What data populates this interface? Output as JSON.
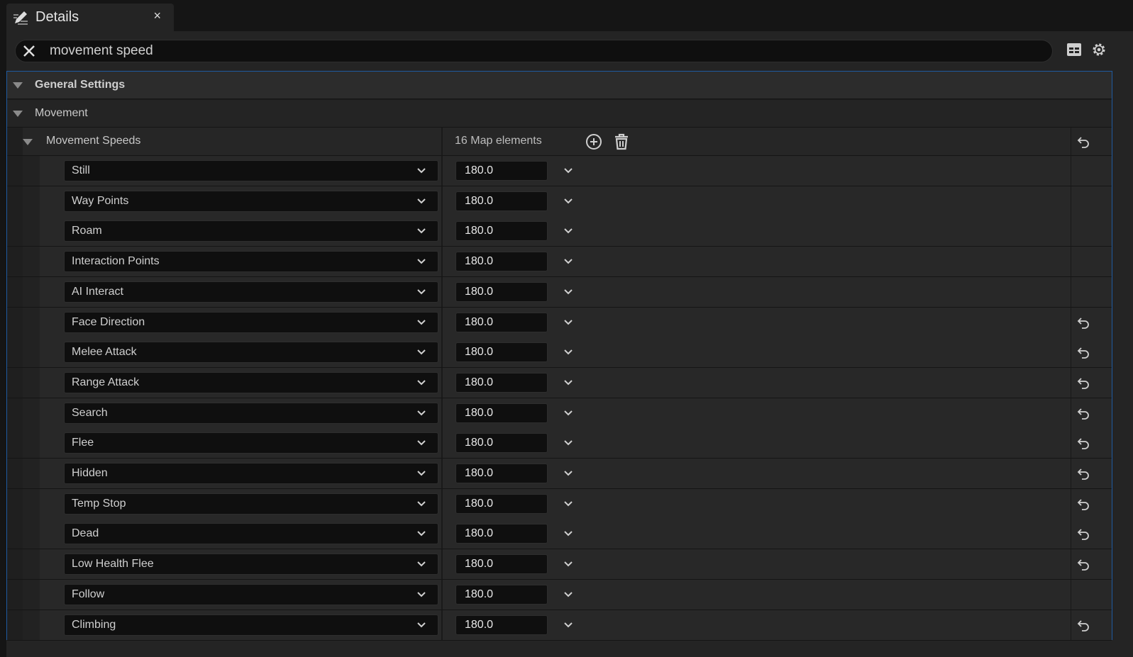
{
  "tab": {
    "title": "Details",
    "close": "×"
  },
  "search": {
    "value": "movement speed"
  },
  "categories": {
    "general": "General Settings",
    "movement": "Movement"
  },
  "map": {
    "label": "Movement Speeds",
    "count": "16 Map elements"
  },
  "rows": [
    {
      "key": "Still",
      "value": "180.0",
      "reset": false
    },
    {
      "key": "Way Points",
      "value": "180.0",
      "reset": false
    },
    {
      "key": "Roam",
      "value": "180.0",
      "reset": false
    },
    {
      "key": "Interaction Points",
      "value": "180.0",
      "reset": false
    },
    {
      "key": "AI Interact",
      "value": "180.0",
      "reset": false
    },
    {
      "key": "Face Direction",
      "value": "180.0",
      "reset": true
    },
    {
      "key": "Melee Attack",
      "value": "180.0",
      "reset": true
    },
    {
      "key": "Range Attack",
      "value": "180.0",
      "reset": true
    },
    {
      "key": "Search",
      "value": "180.0",
      "reset": true
    },
    {
      "key": "Flee",
      "value": "180.0",
      "reset": true
    },
    {
      "key": "Hidden",
      "value": "180.0",
      "reset": true
    },
    {
      "key": "Temp Stop",
      "value": "180.0",
      "reset": true
    },
    {
      "key": "Dead",
      "value": "180.0",
      "reset": true
    },
    {
      "key": "Low Health Flee",
      "value": "180.0",
      "reset": true
    },
    {
      "key": "Follow",
      "value": "180.0",
      "reset": false
    },
    {
      "key": "Climbing",
      "value": "180.0",
      "reset": true
    }
  ]
}
